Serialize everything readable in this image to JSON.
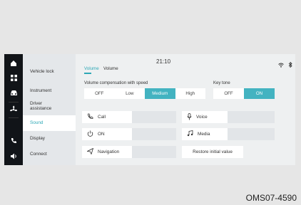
{
  "status_bar": {
    "time": "21:10"
  },
  "rail": {
    "icons": [
      "home-icon",
      "apps-grid-icon",
      "car-icon",
      "fan-icon",
      "phone-icon",
      "speaker-icon"
    ]
  },
  "menu": {
    "items": [
      {
        "label": "Vehicle lock"
      },
      {
        "label": "Instrument"
      },
      {
        "label": "Driver\nassistance"
      },
      {
        "label": "Sound"
      },
      {
        "label": "Display"
      },
      {
        "label": "Connect"
      }
    ],
    "active": "Sound"
  },
  "tabs": [
    {
      "label": "Volume"
    },
    {
      "label": "Volume"
    }
  ],
  "volume_compensation": {
    "label": "Volume compensation with speed",
    "options": [
      "OFF",
      "Low",
      "Medium",
      "High"
    ],
    "selected": "Medium"
  },
  "key_tone": {
    "label": "Key tone",
    "options": [
      "OFF",
      "ON"
    ],
    "selected": "ON"
  },
  "tiles": [
    {
      "label": "Call",
      "icon": "phone-icon"
    },
    {
      "label": "Voice",
      "icon": "microphone-icon"
    },
    {
      "label": "ON",
      "icon": "power-icon"
    },
    {
      "label": "Media",
      "icon": "music-note-icon"
    },
    {
      "label": "Navigation",
      "icon": "navigation-arrow-icon"
    }
  ],
  "restore_button": "Restore initial value",
  "caption": "OMS07-4590",
  "colors": {
    "accent": "#43b3c1",
    "rail": "#111418"
  }
}
